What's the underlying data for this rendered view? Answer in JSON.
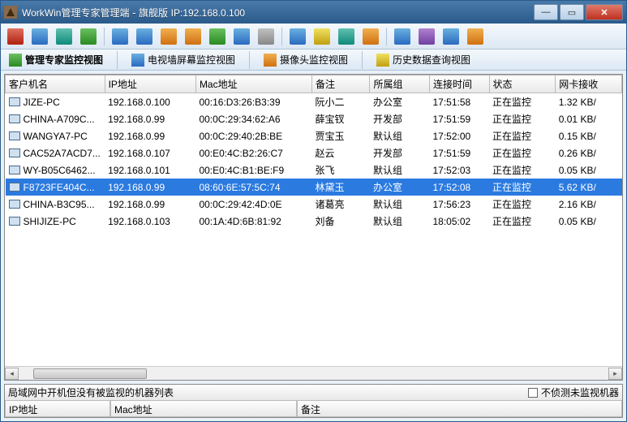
{
  "titlebar": {
    "appname": "WorkWin管理专家管理端",
    "edition": "旗舰版",
    "ip_label": "IP:192.168.0.100"
  },
  "tabs": [
    {
      "label": "管理专家监控视图",
      "icon": "monitor-icon"
    },
    {
      "label": "电视墙屏幕监控视图",
      "icon": "wall-icon"
    },
    {
      "label": "摄像头监控视图",
      "icon": "camera-icon"
    },
    {
      "label": "历史数据查询视图",
      "icon": "history-icon"
    }
  ],
  "columns": {
    "client": "客户机名",
    "ip": "IP地址",
    "mac": "Mac地址",
    "remark": "备注",
    "group": "所属组",
    "conntime": "连接时间",
    "status": "状态",
    "netrecv": "网卡接收"
  },
  "rows": [
    {
      "client": "JIZE-PC",
      "ip": "192.168.0.100",
      "mac": "00:16:D3:26:B3:39",
      "remark": "阮小二",
      "group": "办公室",
      "conntime": "17:51:58",
      "status": "正在监控",
      "net": "1.32 KB/"
    },
    {
      "client": "CHINA-A709C...",
      "ip": "192.168.0.99",
      "mac": "00:0C:29:34:62:A6",
      "remark": "薛宝钗",
      "group": "开发部",
      "conntime": "17:51:59",
      "status": "正在监控",
      "net": "0.01 KB/"
    },
    {
      "client": "WANGYA7-PC",
      "ip": "192.168.0.99",
      "mac": "00:0C:29:40:2B:BE",
      "remark": "贾宝玉",
      "group": "默认组",
      "conntime": "17:52:00",
      "status": "正在监控",
      "net": "0.15 KB/"
    },
    {
      "client": "CAC52A7ACD7...",
      "ip": "192.168.0.107",
      "mac": "00:E0:4C:B2:26:C7",
      "remark": "赵云",
      "group": "开发部",
      "conntime": "17:51:59",
      "status": "正在监控",
      "net": "0.26 KB/"
    },
    {
      "client": "WY-B05C6462...",
      "ip": "192.168.0.101",
      "mac": "00:E0:4C:B1:BE:F9",
      "remark": "张飞",
      "group": "默认组",
      "conntime": "17:52:03",
      "status": "正在监控",
      "net": "0.05 KB/"
    },
    {
      "client": "F8723FE404C...",
      "ip": "192.168.0.99",
      "mac": "08:60:6E:57:5C:74",
      "remark": "林黛玉",
      "group": "办公室",
      "conntime": "17:52:08",
      "status": "正在监控",
      "net": "5.62 KB/",
      "selected": true
    },
    {
      "client": "CHINA-B3C95...",
      "ip": "192.168.0.99",
      "mac": "00:0C:29:42:4D:0E",
      "remark": "诸葛亮",
      "group": "默认组",
      "conntime": "17:56:23",
      "status": "正在监控",
      "net": "2.16 KB/"
    },
    {
      "client": "SHIJIZE-PC",
      "ip": "192.168.0.103",
      "mac": "00:1A:4D:6B:81:92",
      "remark": "刘备",
      "group": "默认组",
      "conntime": "18:05:02",
      "status": "正在监控",
      "net": "0.05 KB/"
    }
  ],
  "bottom": {
    "heading": "局域网中开机但没有被监视的机器列表",
    "checkbox_label": "不侦测未监视机器",
    "cols": {
      "ip": "IP地址",
      "mac": "Mac地址",
      "remark": "备注"
    }
  },
  "toolbar_icons": [
    "c-red",
    "c-blue",
    "c-teal",
    "c-green",
    "c-blue",
    "c-blue",
    "c-orange",
    "c-orange",
    "c-green",
    "c-blue",
    "c-grey",
    "c-blue",
    "c-yellow",
    "c-teal",
    "c-orange",
    "c-blue",
    "c-purple",
    "c-blue",
    "c-orange"
  ]
}
